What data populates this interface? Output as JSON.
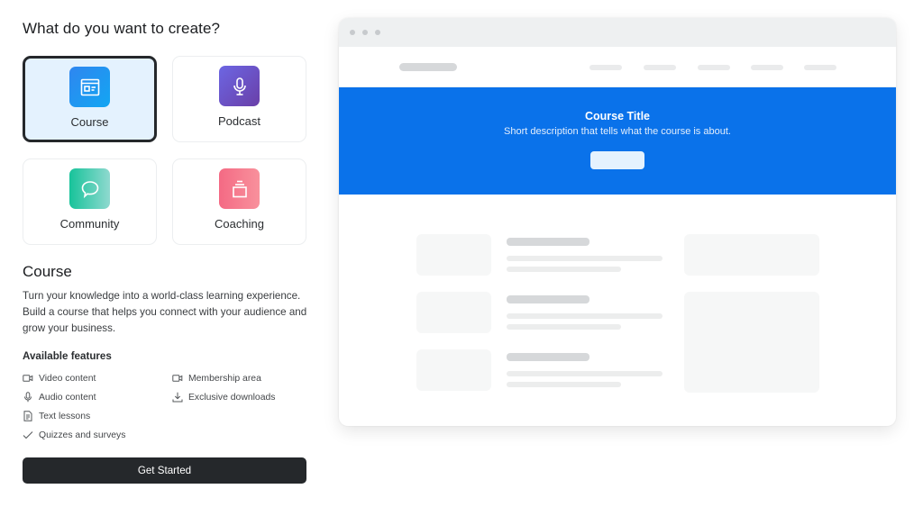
{
  "heading": "What do you want to create?",
  "cards": [
    {
      "label": "Course",
      "icon": "browser-window-icon",
      "selected": true,
      "color_from": "#2f86f0",
      "color_to": "#12a6f2"
    },
    {
      "label": "Podcast",
      "icon": "microphone-icon",
      "selected": false,
      "color_from": "#6c66e3",
      "color_to": "#6a3fa8"
    },
    {
      "label": "Community",
      "icon": "chat-bubble-icon",
      "selected": false,
      "color_from": "#17c39a",
      "color_to": "#8fd9cf"
    },
    {
      "label": "Coaching",
      "icon": "stacked-cards-icon",
      "selected": false,
      "color_from": "#f46a84",
      "color_to": "#f8919c"
    }
  ],
  "detail": {
    "title": "Course",
    "description": "Turn your knowledge into a world-class learning experience. Build a course that helps you connect with your audience and grow your business.",
    "features_title": "Available features",
    "features": [
      {
        "label": "Video content",
        "icon": "video-camera-icon"
      },
      {
        "label": "Audio content",
        "icon": "microphone-icon"
      },
      {
        "label": "Text lessons",
        "icon": "document-icon"
      },
      {
        "label": "Quizzes and surveys",
        "icon": "checkmark-icon"
      },
      {
        "label": "Membership area",
        "icon": "video-camera-icon"
      },
      {
        "label": "Exclusive downloads",
        "icon": "download-icon"
      }
    ]
  },
  "cta_label": "Get Started",
  "preview": {
    "hero_title": "Course Title",
    "hero_subtitle": "Short description that tells what the course is about.",
    "accent": "#0a72ea"
  }
}
